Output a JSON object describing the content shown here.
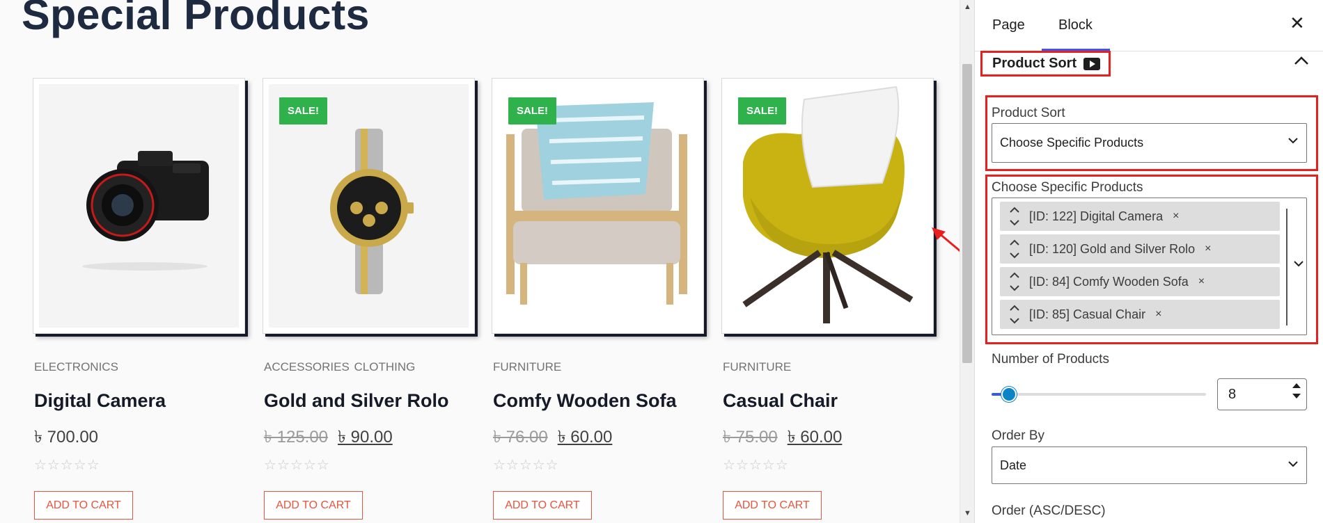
{
  "canvas": {
    "page_title": "Special Products",
    "products": [
      {
        "category": "ELECTRONICS",
        "name": "Digital Camera",
        "old_price": "",
        "price": "৳ 700.00",
        "on_sale": false,
        "sale_label": "",
        "stars": "☆☆☆☆☆",
        "cart_label": "ADD TO CART",
        "image_icon": "camera-icon"
      },
      {
        "category": "ACCESSORIES  CLOTHING",
        "name": "Gold and Silver Rolo",
        "old_price": "৳ 125.00",
        "price": "৳ 90.00",
        "on_sale": true,
        "sale_label": "SALE!",
        "stars": "☆☆☆☆☆",
        "cart_label": "ADD TO CART",
        "image_icon": "watch-icon"
      },
      {
        "category": "FURNITURE",
        "name": "Comfy Wooden Sofa",
        "old_price": "৳ 76.00",
        "price": "৳ 60.00",
        "on_sale": true,
        "sale_label": "SALE!",
        "stars": "☆☆☆☆☆",
        "cart_label": "ADD TO CART",
        "image_icon": "armchair-icon"
      },
      {
        "category": "FURNITURE",
        "name": "Casual Chair",
        "old_price": "৳ 75.00",
        "price": "৳ 60.00",
        "on_sale": true,
        "sale_label": "SALE!",
        "stars": "☆☆☆☆☆",
        "cart_label": "ADD TO CART",
        "image_icon": "chair-icon"
      }
    ]
  },
  "sidebar": {
    "tabs": [
      {
        "label": "Page",
        "active": false
      },
      {
        "label": "Block",
        "active": true
      }
    ],
    "close_icon": "close-icon",
    "panel_title": "Product Sort",
    "panel_video_icon": "video-icon",
    "product_sort": {
      "label": "Product Sort",
      "value": "Choose Specific Products"
    },
    "specific_products": {
      "label": "Choose Specific Products",
      "tokens": [
        "[ID: 122] Digital Camera",
        "[ID: 120] Gold and Silver Rolo",
        "[ID: 84] Comfy Wooden Sofa",
        "[ID: 85] Casual Chair"
      ],
      "remove_glyph": "×"
    },
    "number_of_products": {
      "label": "Number of Products",
      "value": "8",
      "fraction": 0.08
    },
    "order_by": {
      "label": "Order By",
      "value": "Date"
    },
    "order": {
      "label": "Order (ASC/DESC)"
    }
  },
  "colors": {
    "accent": "#3858e9",
    "sale_badge": "#2fb24c",
    "cart_button": "#e8543d",
    "annotation": "#e61f1f",
    "title": "#1d2a3f"
  }
}
